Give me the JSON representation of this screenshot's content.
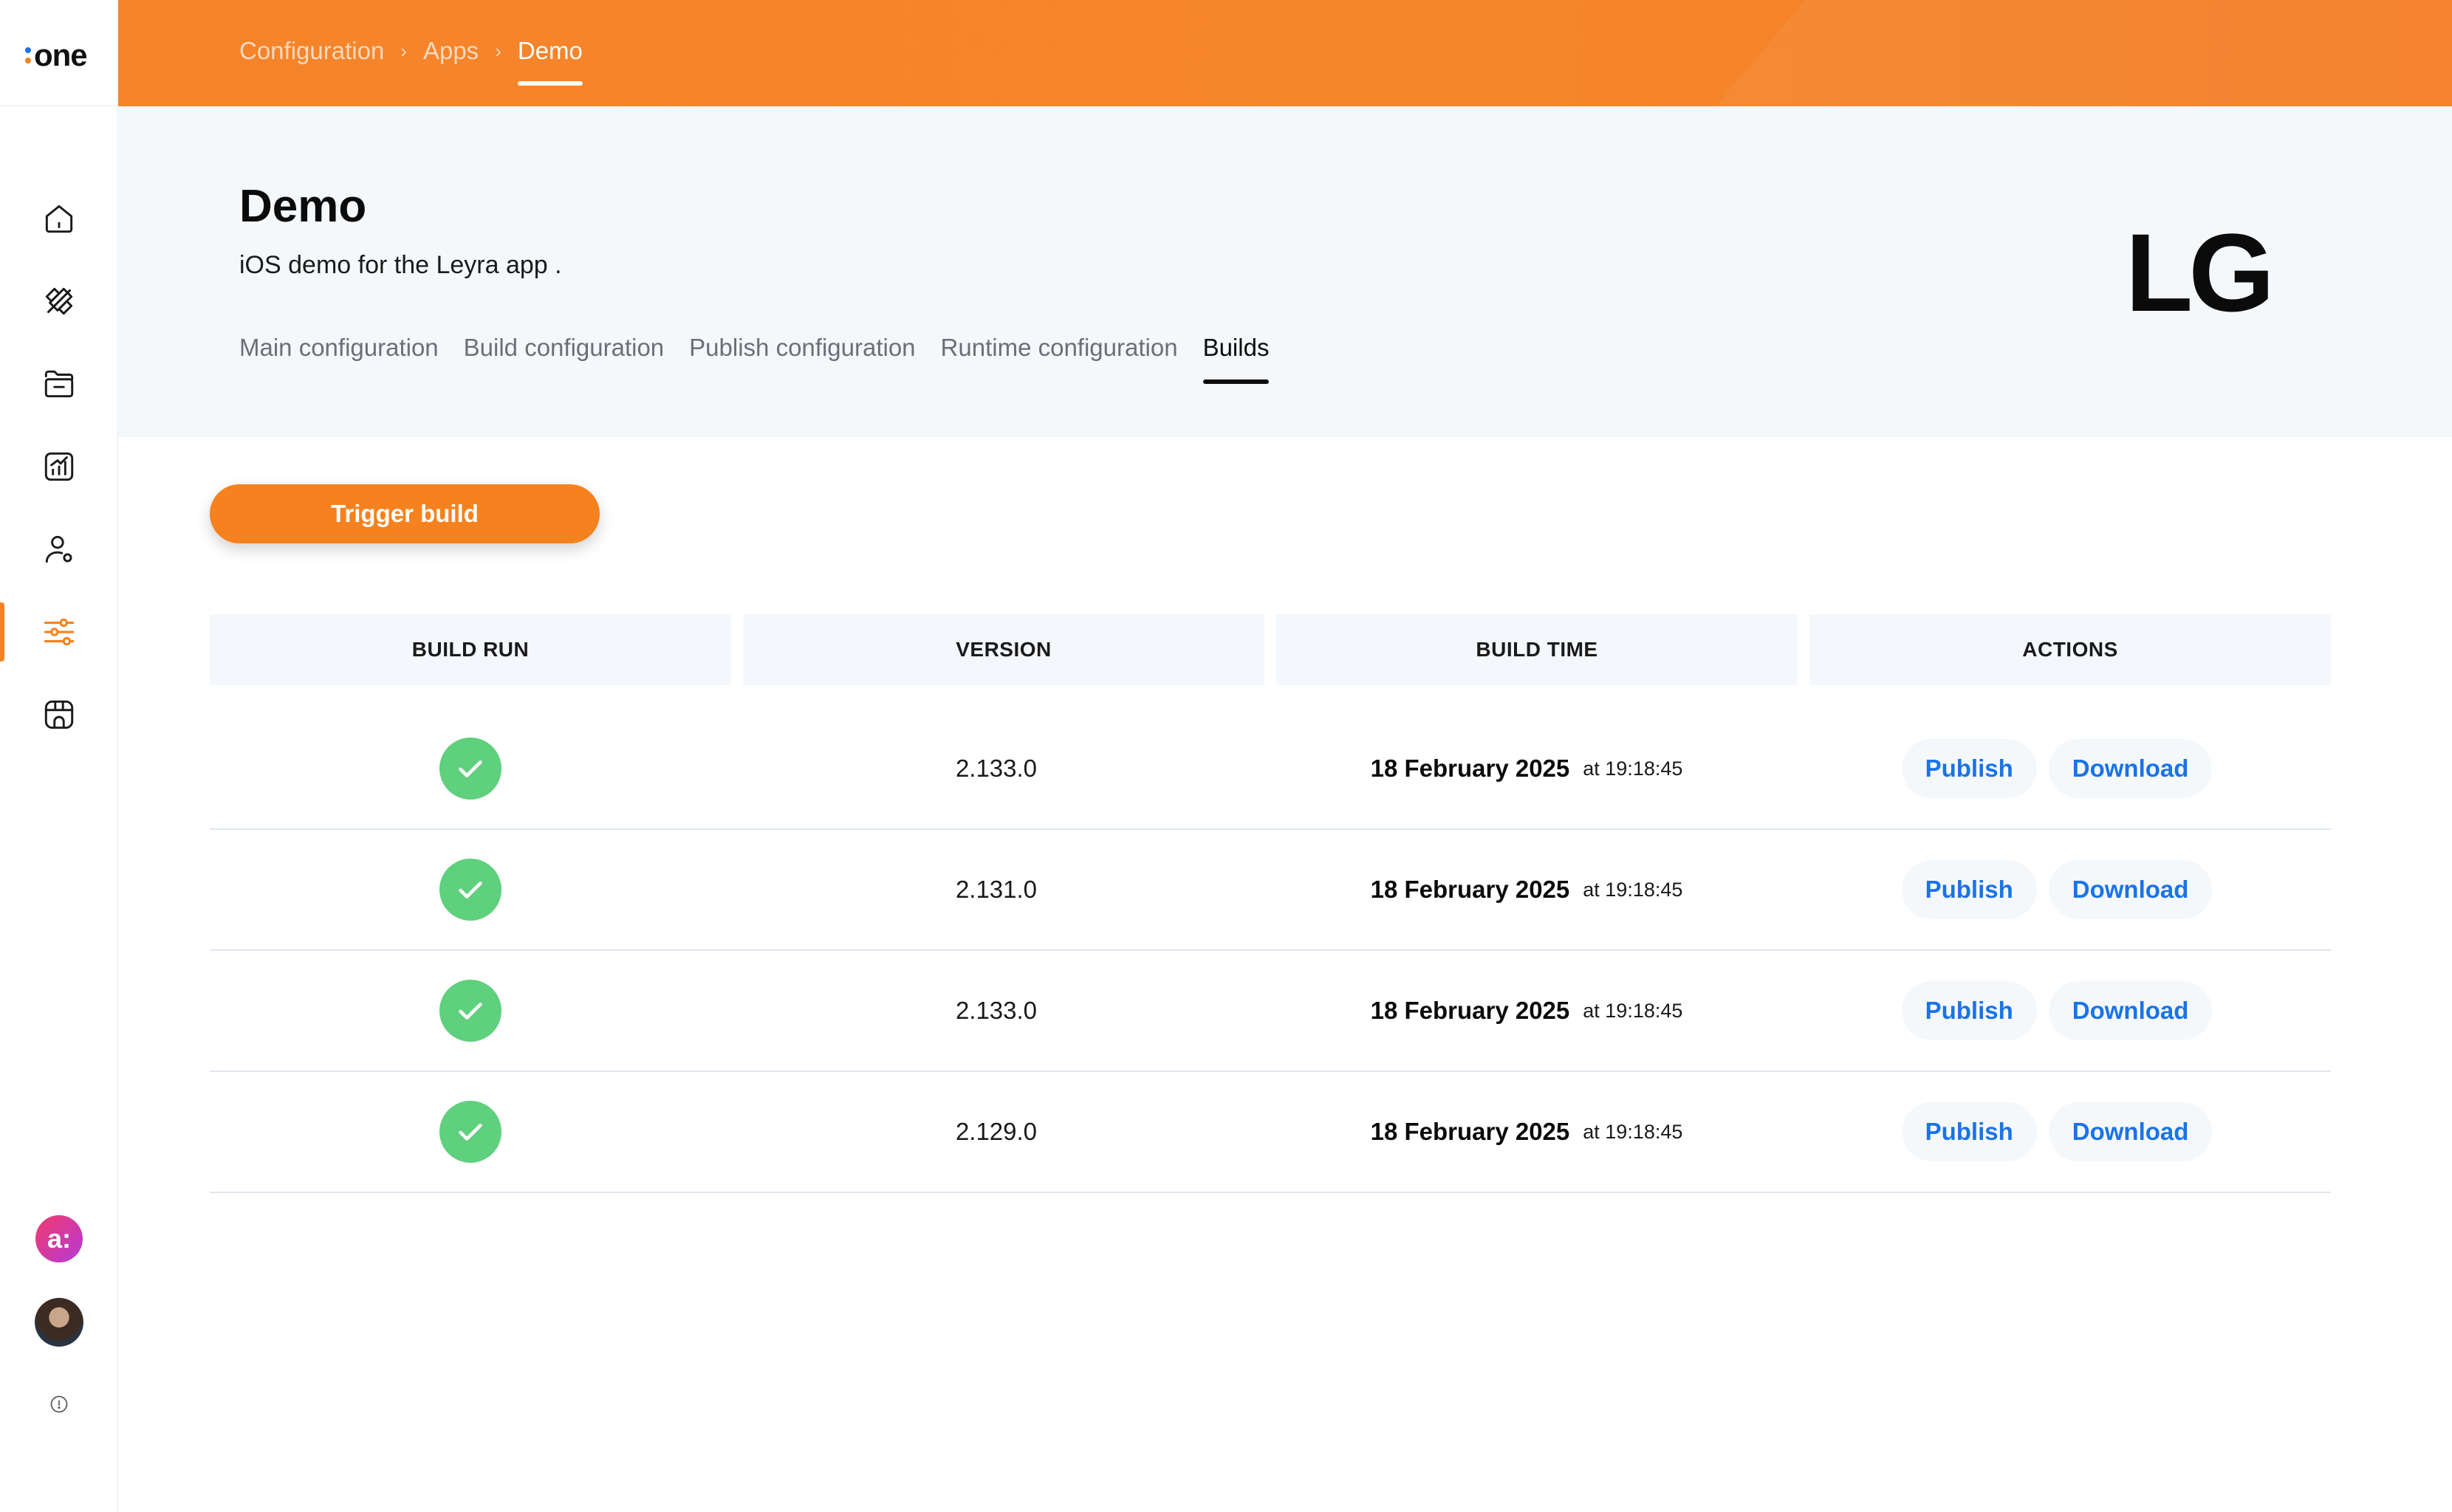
{
  "brand": {
    "logo_text": "one",
    "dot_colors": [
      "#1a73e8",
      "#f5821f"
    ]
  },
  "sidebar": {
    "items": [
      {
        "name": "home",
        "icon": "home-icon"
      },
      {
        "name": "design",
        "icon": "design-tools-icon"
      },
      {
        "name": "folder",
        "icon": "folder-icon"
      },
      {
        "name": "analytics",
        "icon": "analytics-icon"
      },
      {
        "name": "users",
        "icon": "user-settings-icon"
      },
      {
        "name": "configuration",
        "icon": "sliders-icon",
        "active": true
      },
      {
        "name": "store",
        "icon": "store-icon"
      }
    ],
    "brand_avatar_text": "a:",
    "active_color": "#f5821f"
  },
  "breadcrumb": [
    "Configuration",
    "Apps",
    "Demo"
  ],
  "breadcrumb_separator": "›",
  "page": {
    "title": "Demo",
    "description": "iOS demo for the Leyra app  .",
    "app_logo_text": "LG"
  },
  "tabs": [
    {
      "label": "Main configuration"
    },
    {
      "label": "Build configuration"
    },
    {
      "label": "Publish configuration"
    },
    {
      "label": "Runtime configuration"
    },
    {
      "label": "Builds",
      "active": true
    }
  ],
  "trigger_button": "Trigger build",
  "table": {
    "headers": [
      "BUILD RUN",
      "VERSION",
      "BUILD TIME",
      "ACTIONS"
    ],
    "rows": [
      {
        "status": "success",
        "version": "2.133.0",
        "date": "18 February 2025",
        "time": "at 19:18:45",
        "actions": [
          "Publish",
          "Download"
        ]
      },
      {
        "status": "success",
        "version": "2.131.0",
        "date": "18 February 2025",
        "time": "at 19:18:45",
        "actions": [
          "Publish",
          "Download"
        ]
      },
      {
        "status": "success",
        "version": "2.133.0",
        "date": "18 February 2025",
        "time": "at 19:18:45",
        "actions": [
          "Publish",
          "Download"
        ]
      },
      {
        "status": "success",
        "version": "2.129.0",
        "date": "18 February 2025",
        "time": "at 19:18:45",
        "actions": [
          "Publish",
          "Download"
        ]
      }
    ]
  },
  "colors": {
    "accent": "#f5821f",
    "success": "#5fd07d",
    "link": "#1a73e8"
  }
}
